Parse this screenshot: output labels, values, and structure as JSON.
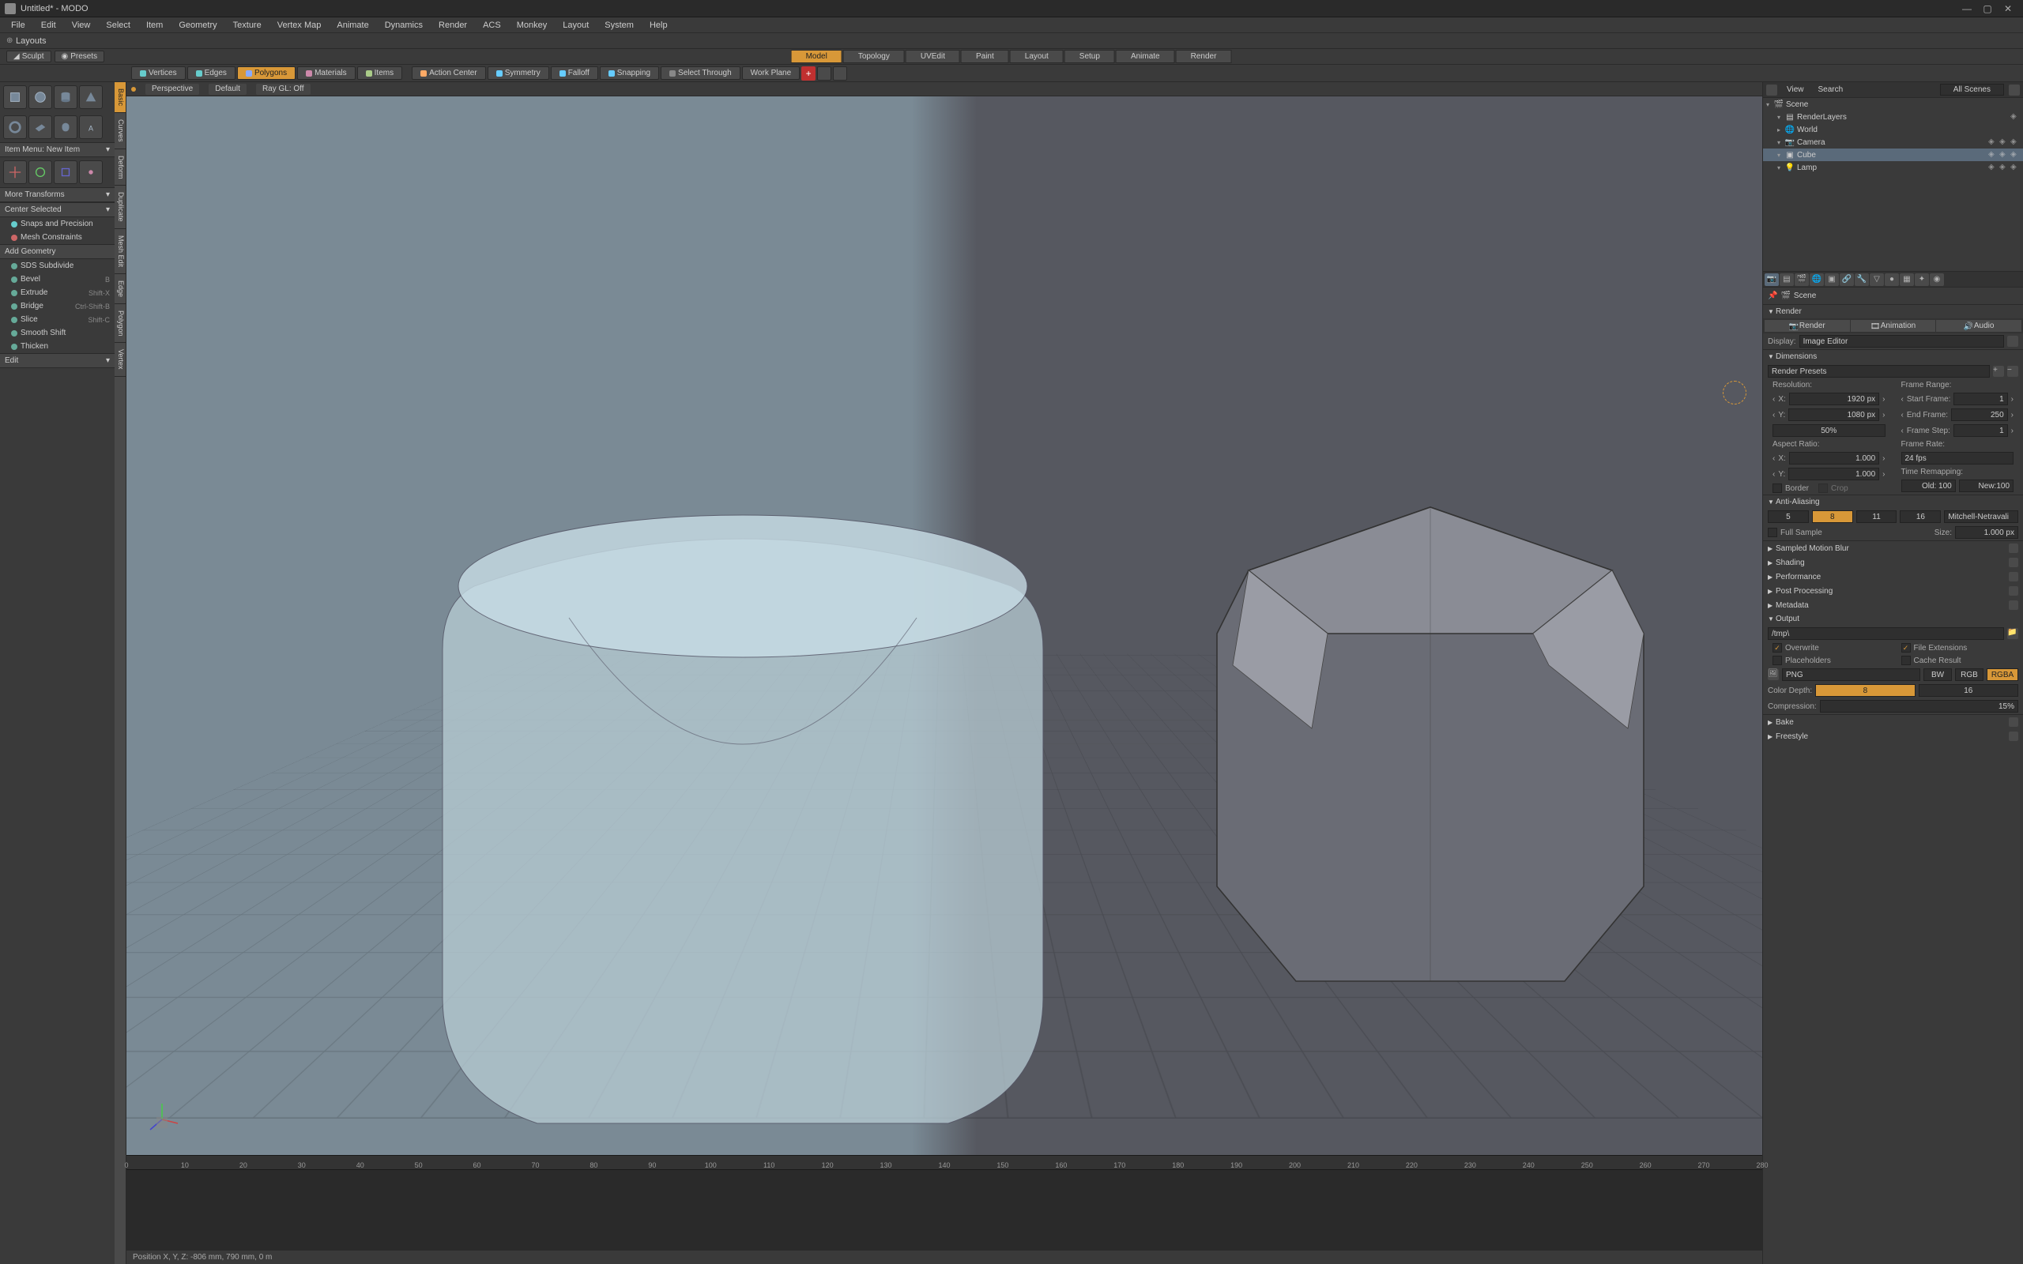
{
  "window": {
    "title": "Untitled* - MODO"
  },
  "menubar": [
    "File",
    "Edit",
    "View",
    "Select",
    "Item",
    "Geometry",
    "Texture",
    "Vertex Map",
    "Animate",
    "Dynamics",
    "Render",
    "ACS",
    "Monkey",
    "Layout",
    "System",
    "Help"
  ],
  "layouts_label": "Layouts",
  "top_tools": {
    "sculpt": "Sculpt",
    "presets": "Presets"
  },
  "layout_tabs": [
    "Model",
    "Topology",
    "UVEdit",
    "Paint",
    "Layout",
    "Setup",
    "Animate",
    "Render"
  ],
  "layout_tabs_active": "Model",
  "mode_toolbar": {
    "vertices": "Vertices",
    "edges": "Edges",
    "polygons": "Polygons",
    "materials": "Materials",
    "items": "Items",
    "action_center": "Action Center",
    "symmetry": "Symmetry",
    "falloff": "Falloff",
    "snapping": "Snapping",
    "select_through": "Select Through",
    "work_plane": "Work Plane"
  },
  "mode_active": "Polygons",
  "viewport_header": {
    "perspective": "Perspective",
    "default": "Default",
    "raygl": "Ray GL: Off"
  },
  "left_vert_tabs": [
    "Basic",
    "Curves",
    "Deform",
    "Duplicate",
    "Mesh Edit",
    "Edge",
    "Polygon",
    "Vertex"
  ],
  "left_vert_active": "Basic",
  "left_panels": {
    "item_menu": "Item Menu: New Item",
    "more_transforms": "More Transforms",
    "center_selected": "Center Selected",
    "snaps_precision": "Snaps and Precision",
    "mesh_constraints": "Mesh Constraints",
    "add_geometry": "Add Geometry",
    "geo_items": [
      {
        "label": "SDS Subdivide",
        "sc": ""
      },
      {
        "label": "Bevel",
        "sc": "B"
      },
      {
        "label": "Extrude",
        "sc": "Shift-X"
      },
      {
        "label": "Bridge",
        "sc": "Ctrl-Shift-B"
      },
      {
        "label": "Slice",
        "sc": "Shift-C"
      },
      {
        "label": "Smooth Shift",
        "sc": ""
      },
      {
        "label": "Thicken",
        "sc": ""
      }
    ],
    "edit": "Edit"
  },
  "statusbar": "Position X, Y, Z:   -806 mm, 790 mm, 0 m",
  "timeline": {
    "start": 0,
    "end": 280,
    "step": 10
  },
  "right_header": {
    "view": "View",
    "search": "Search",
    "filter": "All Scenes"
  },
  "outliner": [
    {
      "indent": 0,
      "label": "Scene",
      "icon": "scene",
      "expanded": true
    },
    {
      "indent": 1,
      "label": "RenderLayers",
      "icon": "layers",
      "expanded": true,
      "righticons": [
        "img"
      ]
    },
    {
      "indent": 1,
      "label": "World",
      "icon": "world"
    },
    {
      "indent": 1,
      "label": "Camera",
      "icon": "camera",
      "expanded": true,
      "righticons": [
        "eye",
        "sel",
        "render"
      ]
    },
    {
      "indent": 1,
      "label": "Cube",
      "icon": "mesh",
      "selected": true,
      "expanded": true,
      "righticons": [
        "eye",
        "sel",
        "render"
      ]
    },
    {
      "indent": 1,
      "label": "Lamp",
      "icon": "lamp",
      "expanded": true,
      "righticons": [
        "eye",
        "sel",
        "render"
      ]
    }
  ],
  "breadcrumb": {
    "scene": "Scene"
  },
  "render_section": "Render",
  "render_tabs": {
    "render": "Render",
    "animation": "Animation",
    "audio": "Audio"
  },
  "display_row": {
    "label": "Display:",
    "value": "Image Editor"
  },
  "dimensions": {
    "header": "Dimensions",
    "presets": "Render Presets",
    "resolution": "Resolution:",
    "x": "X:",
    "x_val": "1920 px",
    "y": "Y:",
    "y_val": "1080 px",
    "pct": "50%",
    "frame_range": "Frame Range:",
    "start": "Start Frame:",
    "start_val": "1",
    "end": "End Frame:",
    "end_val": "250",
    "step": "Frame Step:",
    "step_val": "1",
    "aspect": "Aspect Ratio:",
    "ax": "X:",
    "ax_val": "1.000",
    "ay": "Y:",
    "ay_val": "1.000",
    "frame_rate": "Frame Rate:",
    "fps": "24 fps",
    "time_remap": "Time Remapping:",
    "old": "Old: 100",
    "new": "New:100",
    "border": "Border",
    "crop": "Crop"
  },
  "aa": {
    "header": "Anti-Aliasing",
    "s5": "5",
    "s8": "8",
    "s11": "11",
    "s16": "16",
    "filter": "Mitchell-Netravali",
    "full_sample": "Full Sample",
    "size": "Size:",
    "size_val": "1.000 px"
  },
  "collapsed_sections": [
    "Sampled Motion Blur",
    "Shading",
    "Performance",
    "Post Processing",
    "Metadata"
  ],
  "output": {
    "header": "Output",
    "path": "/tmp\\",
    "overwrite": "Overwrite",
    "file_ext": "File Extensions",
    "placeholders": "Placeholders",
    "cache": "Cache Result",
    "format": "PNG",
    "bw": "BW",
    "rgb": "RGB",
    "rgba": "RGBA",
    "color_depth": "Color Depth:",
    "d8": "8",
    "d16": "16",
    "compression": "Compression:",
    "compression_val": "15%"
  },
  "bake": "Bake",
  "freestyle": "Freestyle"
}
